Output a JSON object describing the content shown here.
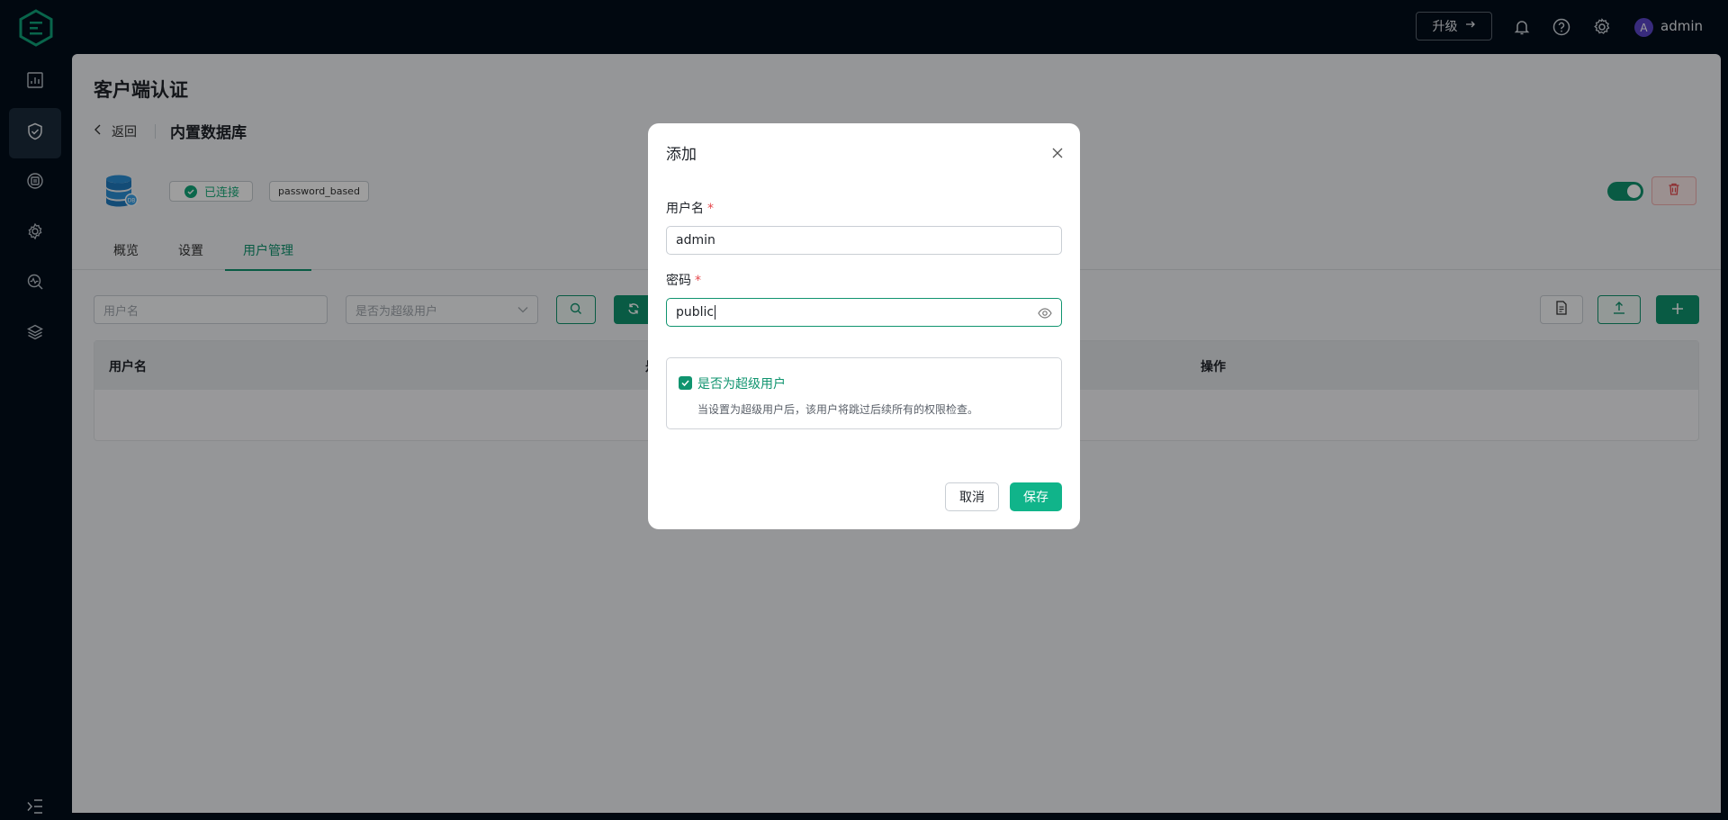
{
  "header": {
    "upgrade_label": "升级",
    "avatar_initial": "A",
    "username": "admin"
  },
  "page": {
    "title": "客户端认证",
    "back_label": "返回",
    "subtitle": "内置数据库",
    "status_label": "已连接",
    "mechanism_label": "password_based",
    "enabled": true
  },
  "tabs": [
    {
      "label": "概览",
      "active": false
    },
    {
      "label": "设置",
      "active": false
    },
    {
      "label": "用户管理",
      "active": true
    }
  ],
  "filters": {
    "username_placeholder": "用户名",
    "superuser_placeholder": "是否为超级用户"
  },
  "table": {
    "columns": [
      "用户名",
      "是",
      "操作"
    ]
  },
  "dialog": {
    "title": "添加",
    "username_label": "用户名",
    "username_value": "admin",
    "password_label": "密码",
    "password_value": "public",
    "required_mark": "*",
    "superuser_label": "是否为超级用户",
    "superuser_checked": true,
    "superuser_help": "当设置为超级用户后，该用户将跳过后续所有的权限检查。",
    "cancel_label": "取消",
    "save_label": "保存"
  },
  "colors": {
    "accent": "#10946f",
    "primary_button": "#10b48a",
    "header_bg": "#020d1a",
    "danger": "#e5484d"
  }
}
